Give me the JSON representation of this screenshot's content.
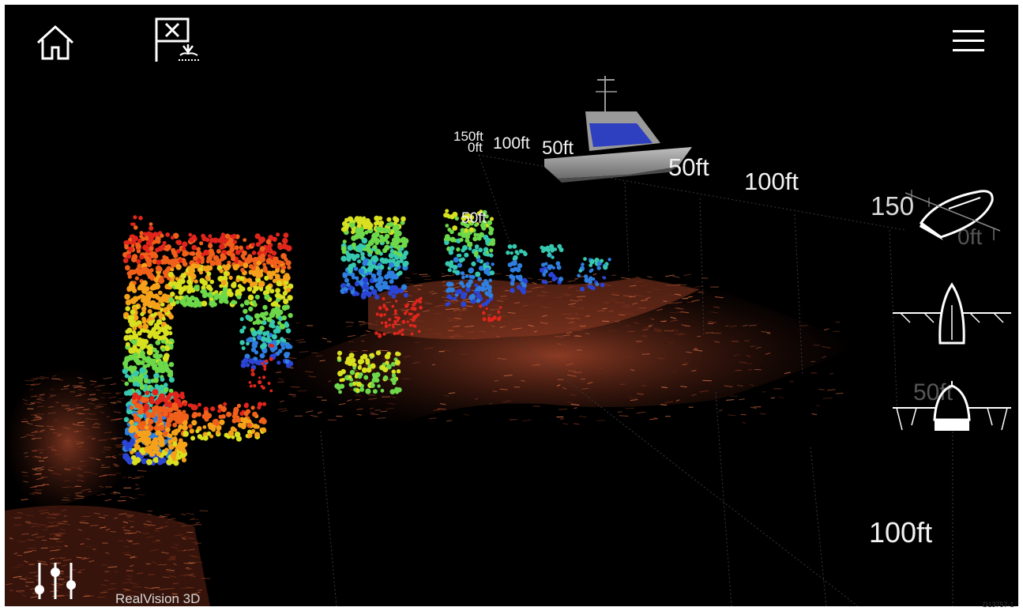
{
  "toolbar": {
    "home_icon": "home-icon",
    "waypoint_icon": "mob-waypoint-flag-icon",
    "menu_icon": "hamburger-menu-icon",
    "settings_icon": "sliders-icon"
  },
  "view_controls": [
    {
      "name": "view-side-angle-button",
      "icon": "boat-side-view-icon"
    },
    {
      "name": "view-top-down-button",
      "icon": "boat-top-view-icon"
    },
    {
      "name": "view-forward-button",
      "icon": "boat-front-view-icon"
    }
  ],
  "range_labels": {
    "r150_back": "150ft",
    "r0_back": "0ft",
    "r100_back": "100ft",
    "r50_near_boat": "50ft",
    "r50_mid": "50ft",
    "r100_mid": "100ft",
    "r150_right": "150",
    "r0_right": "0ft",
    "r50_small": "50ft",
    "r50_front": "50ft",
    "r100_bottom": "100ft"
  },
  "mode_label": "RealVision 3D",
  "figure_code": "D13757-1",
  "colors": {
    "background": "#000000",
    "seabed": "#a2452a",
    "depth_shallow": "#e62a1e",
    "depth_mid": "#4ad06a",
    "depth_deep": "#2b47d8",
    "ui": "#ffffff"
  }
}
